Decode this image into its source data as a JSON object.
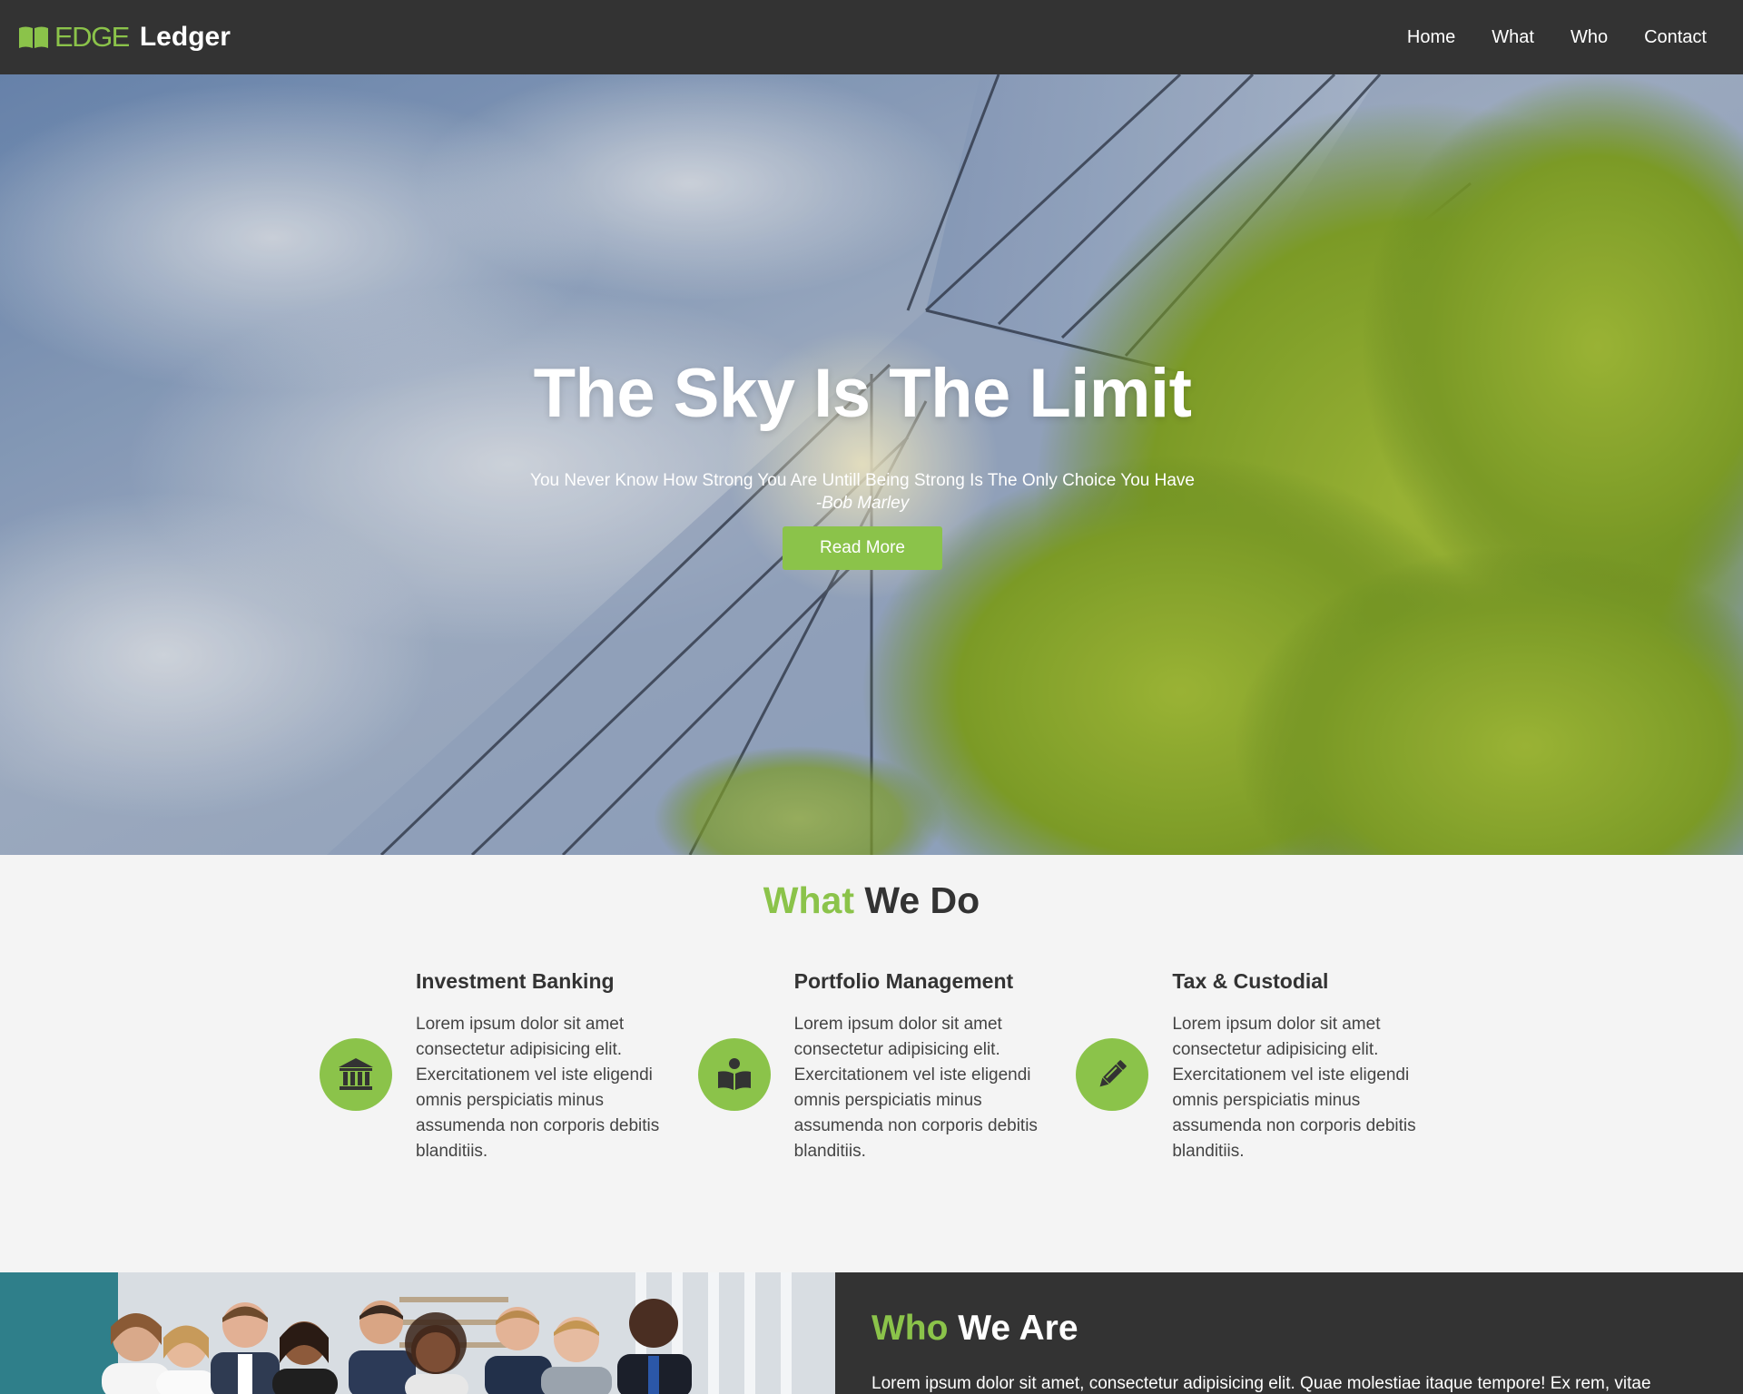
{
  "navbar": {
    "brand_edge": "EDGE",
    "brand_ledger": "Ledger",
    "links": [
      "Home",
      "What",
      "Who",
      "Contact"
    ]
  },
  "hero": {
    "title": "The Sky Is The Limit",
    "quote": "You Never Know How Strong You Are Untill Being Strong Is The Only Choice You Have",
    "author": "-Bob Marley",
    "button": "Read More"
  },
  "what": {
    "title_accent": "What",
    "title_rest": " We Do",
    "services": [
      {
        "title": "Investment Banking",
        "icon": "bank-icon",
        "desc": "Lorem ipsum dolor sit amet consectetur adipisicing elit. Exercitationem vel iste eligendi omnis perspiciatis minus assumenda non corporis debitis blanditiis."
      },
      {
        "title": "Portfolio Management",
        "icon": "reader-icon",
        "desc": "Lorem ipsum dolor sit amet consectetur adipisicing elit. Exercitationem vel iste eligendi omnis perspiciatis minus assumenda non corporis debitis blanditiis."
      },
      {
        "title": "Tax & Custodial",
        "icon": "pencil-icon",
        "desc": "Lorem ipsum dolor sit amet consectetur adipisicing elit. Exercitationem vel iste eligendi omnis perspiciatis minus assumenda non corporis debitis blanditiis."
      }
    ]
  },
  "who": {
    "title_accent": "Who",
    "title_rest": " We Are",
    "body": "Lorem ipsum dolor sit amet, consectetur adipisicing elit. Quae molestiae itaque tempore! Ex rem, vitae"
  },
  "colors": {
    "accent": "#8bc34a",
    "dark": "#333333",
    "light_bg": "#f4f4f4"
  }
}
